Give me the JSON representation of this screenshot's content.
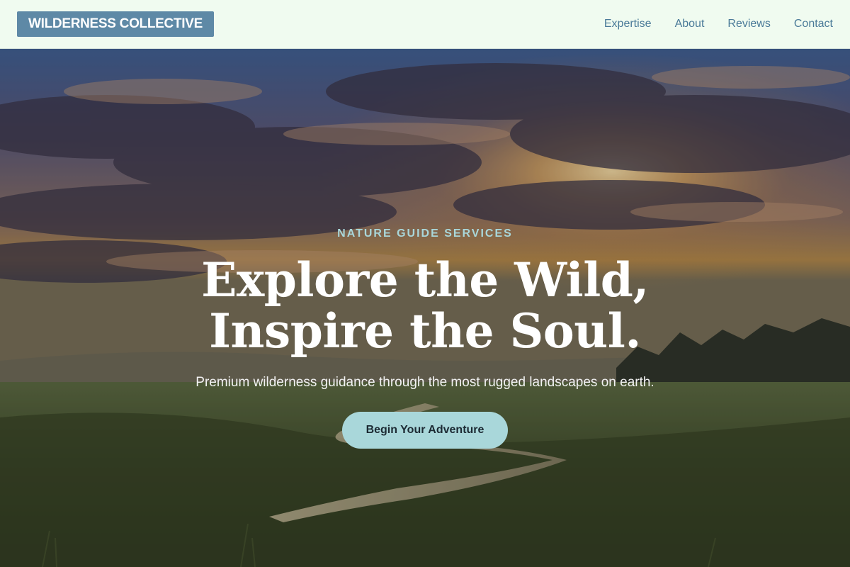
{
  "header": {
    "logo": "WILDERNESS COLLECTIVE",
    "nav": [
      {
        "label": "Expertise"
      },
      {
        "label": "About"
      },
      {
        "label": "Reviews"
      },
      {
        "label": "Contact"
      }
    ]
  },
  "hero": {
    "eyebrow": "NATURE GUIDE SERVICES",
    "headline": "Explore the Wild, Inspire the Soul.",
    "subtitle": "Premium wilderness guidance through the most rugged landscapes on earth.",
    "cta": "Begin Your Adventure"
  },
  "colors": {
    "header_bg": "#f0fbf0",
    "logo_bg": "#5e89a6",
    "nav_text": "#4a7a98",
    "accent": "#a9d7da"
  }
}
